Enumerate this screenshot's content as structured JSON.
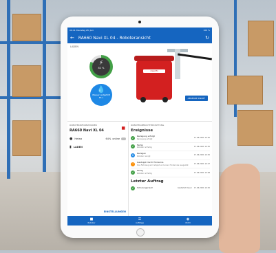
{
  "status_bar": {
    "time": "09:41  Dienstag 28. Juni",
    "battery": "100 %"
  },
  "app_bar": {
    "back_icon": "back-arrow-icon",
    "title": "RA660 Navi XL 04 - Roboteransicht",
    "refresh_icon": "refresh-icon"
  },
  "hero": {
    "section_label": "LADEN",
    "battery_label": "82 %",
    "water_label": "Wasser aufgefüllt",
    "water_sub": "65 L",
    "button_label": "ABSENDE KNOPF",
    "robot_brand": "cleanfix"
  },
  "robot_info": {
    "caption": "ROBOTERINFORMATIONEN",
    "name": "RA660 Navi XL 04",
    "location": "Heiwa",
    "battery": "64%",
    "online": "online",
    "state": "LADEN",
    "settings_label": "EINSTELLUNGEN"
  },
  "events": {
    "caption": "ROBOTER-BERICHTERSTATTUNG",
    "title": "Ereignisse",
    "items": [
      {
        "title": "Reinigung erfolgt",
        "sub": "Reinigung erfolgt",
        "time": "17.06.2021 10:55",
        "status": "ok"
      },
      {
        "title": "Fertig",
        "sub": "Roboter ist fertig",
        "time": "17.06.2021 10:55",
        "status": "ok"
      },
      {
        "title": "Reinigen",
        "sub": "Roboter reinigt",
        "time": "17.06.2021 10:25",
        "status": "info"
      },
      {
        "title": "Gestoppt durch Hindernis",
        "sub": "Das Fahrzeug wird stoppt und einen Hinderniss ausgelöst",
        "time": "17.06.2021 10:27",
        "status": "warn"
      },
      {
        "title": "Fertig",
        "sub": "Roboter ist fertig",
        "time": "17.06.2021 10:48",
        "status": "ok"
      }
    ]
  },
  "last_order": {
    "title": "Letzter Auftrag",
    "item": {
      "name": "Schulungsraum",
      "mid": "Gestartet Dauer",
      "time": "17.06.2021 10:25",
      "status": "ok"
    }
  },
  "nav": [
    {
      "label": "Roboter",
      "icon": "robot-icon"
    },
    {
      "label": "Aufträge",
      "icon": "list-icon"
    },
    {
      "label": "Profil",
      "icon": "profile-icon"
    }
  ],
  "colors": {
    "primary": "#1565c0",
    "ok": "#43a047",
    "info": "#1e88e5",
    "warn": "#fb8c00",
    "robot": "#d32020"
  }
}
